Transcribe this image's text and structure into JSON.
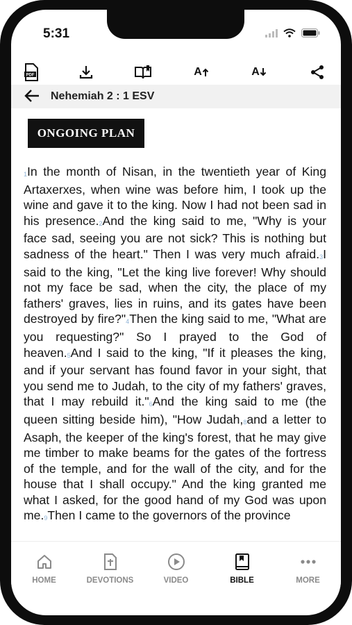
{
  "status": {
    "time": "5:31"
  },
  "toolbar": {
    "items": [
      {
        "icon": "pdf-icon"
      },
      {
        "icon": "download-icon"
      },
      {
        "icon": "book-bookmark-icon"
      },
      {
        "icon": "font-increase-icon",
        "text": "A"
      },
      {
        "icon": "font-decrease-icon",
        "text": "A"
      },
      {
        "icon": "share-icon"
      }
    ]
  },
  "nav": {
    "title": "Nehemiah 2 : 1 ESV"
  },
  "plan": {
    "label": "ONGOING PLAN"
  },
  "verses": [
    {
      "n": "1",
      "text": "In the month of Nisan, in the twentieth year of King Artaxerxes, when wine was before him, I took up the wine and gave it to the king. Now I had not been sad in his presence."
    },
    {
      "n": "2",
      "text": "And the king said to me, \"Why is your face sad, seeing you are not sick? This is nothing but sadness of the heart.\" Then I was very much afraid."
    },
    {
      "n": "3",
      "text": "I said to the king, \"Let the king live forever! Why should not my face be sad, when the city, the place of my fathers' graves, lies in ruins, and its gates have been destroyed by fire?\""
    },
    {
      "n": "4",
      "text": "Then the king said to me, \"What are you requesting?\" So I prayed to the God of heaven."
    },
    {
      "n": "5",
      "text": "And I said to the king, \"If it pleases the king, and if your servant has found favor in your sight, that you send me to Judah, to the city of my fathers' graves, that I may rebuild it.\""
    },
    {
      "n": "6",
      "text": "And the king said to me (the queen sitting beside him), \"How Judah,"
    },
    {
      "n": "8",
      "text": "and a letter to Asaph, the keeper of the king's forest, that he may give me timber to make beams for the gates of the fortress of the temple, and for the wall of the city, and for the house that I shall occupy.\" And the king granted me what I asked, for the good hand of my God was upon me."
    },
    {
      "n": "9",
      "text": "Then I came to the governors of the province"
    }
  ],
  "tabs": [
    {
      "label": "HOME",
      "icon": "home-icon",
      "active": false
    },
    {
      "label": "DEVOTIONS",
      "icon": "devotions-icon",
      "active": false
    },
    {
      "label": "VIDEO",
      "icon": "play-icon",
      "active": false
    },
    {
      "label": "BIBLE",
      "icon": "bible-icon",
      "active": true
    },
    {
      "label": "MORE",
      "icon": "more-icon",
      "active": false
    }
  ],
  "colors": {
    "verse_number": "#8fb3d6",
    "accent": "#111111",
    "inactive_tab": "#8a8a8a"
  }
}
